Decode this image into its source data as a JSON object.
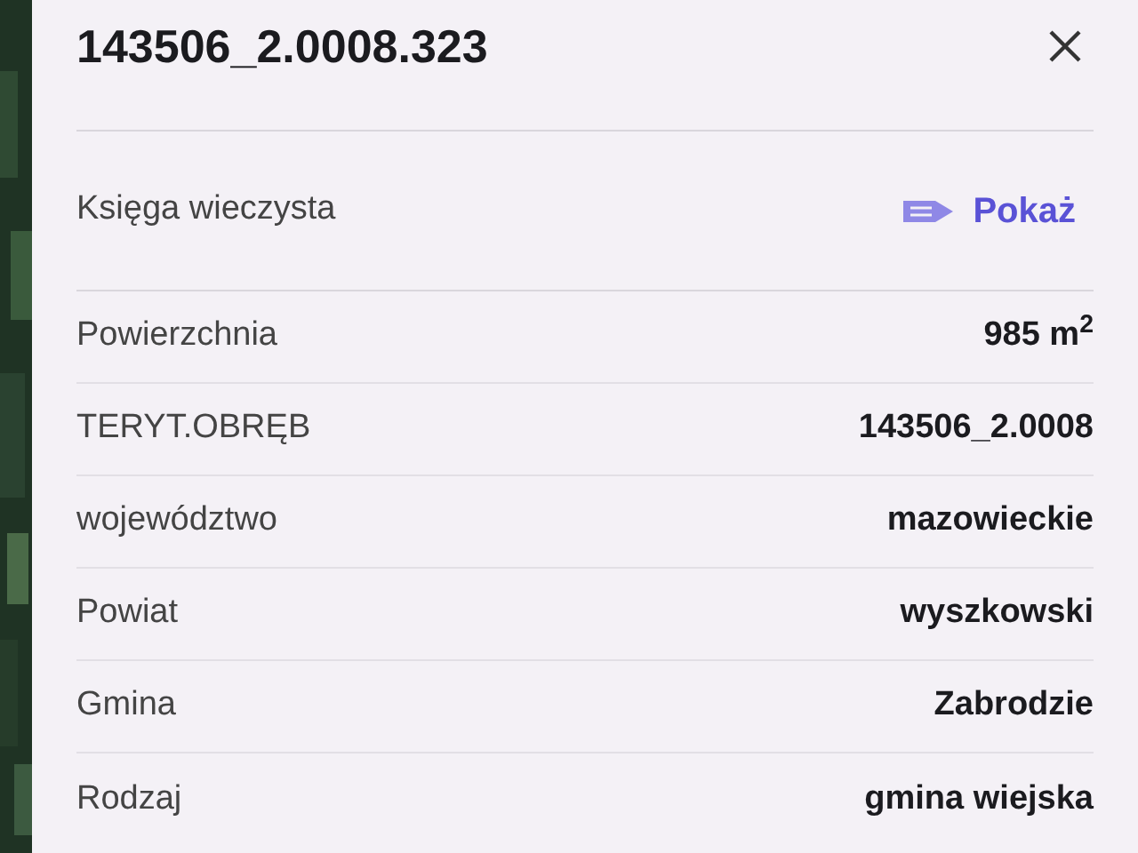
{
  "panel": {
    "title": "143506_2.0008.323",
    "link_row": {
      "label": "Księga wieczysta",
      "action": "Pokaż"
    },
    "rows": [
      {
        "label": "Powierzchnia",
        "value": "985 m$^{2}$"
      },
      {
        "label": "TERYT.OBRĘB",
        "value": "143506_2.0008"
      },
      {
        "label": "województwo",
        "value": "mazowieckie"
      },
      {
        "label": "Powiat",
        "value": "wyszkowski"
      },
      {
        "label": "Gmina",
        "value": "Zabrodzie"
      },
      {
        "label": "Rodzaj",
        "value": "gmina wiejska"
      }
    ]
  }
}
